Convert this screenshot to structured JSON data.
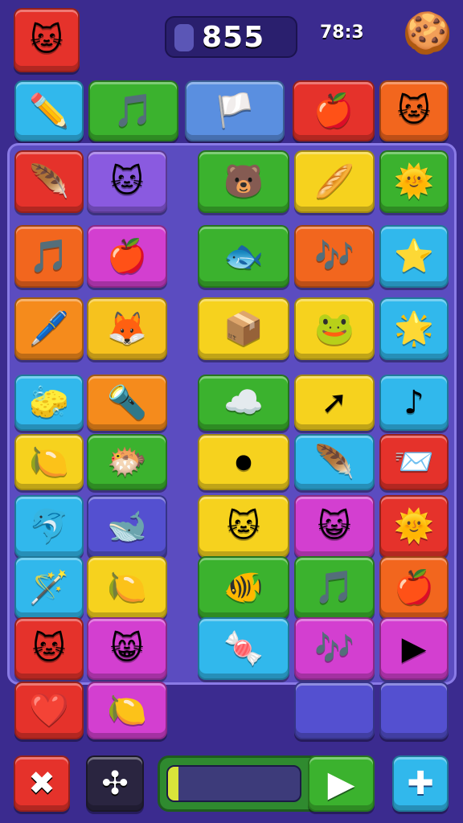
{
  "hud": {
    "score": "855",
    "timer": "78:3"
  },
  "level_progress": 0.08,
  "colors": {
    "background": "#3b2b8f",
    "board": "#5b4cc0",
    "red": "#e5322b",
    "green": "#3bb22e",
    "blue": "#31a8ec",
    "yellow": "#f6d21e",
    "orange": "#f58b1c",
    "purple": "#7a3fd6",
    "magenta": "#d33fd0",
    "indigo": "#5450d0"
  },
  "top_row": [
    {
      "icon": "pencil-icon",
      "glyph": "✏️",
      "color": "#31b8ec"
    },
    {
      "icon": "music-note-icon",
      "glyph": "🎵",
      "color": "#3bb22e"
    },
    {
      "icon": "flag-icon",
      "glyph": "🏳️",
      "color": "#5a8fe0"
    },
    {
      "icon": "apple-icon",
      "glyph": "🍎",
      "color": "#e5322b"
    },
    {
      "icon": "cat-face-icon",
      "glyph": "🐱",
      "color": "#f2661e"
    }
  ],
  "grid_tiles": [
    {
      "icon": "feather-duster-icon",
      "glyph": "🪶",
      "color": "#e5322b"
    },
    {
      "icon": "cat-face-icon",
      "glyph": "🐱",
      "color": "#8a5ae0"
    },
    {
      "icon": "bear-face-icon",
      "glyph": "🐻",
      "color": "#3bb22e"
    },
    {
      "icon": "rolling-pin-icon",
      "glyph": "🥖",
      "color": "#f6d21e"
    },
    {
      "icon": "sun-icon",
      "glyph": "🌞",
      "color": "#3bb22e"
    },
    {
      "icon": "music-note-icon",
      "glyph": "🎵",
      "color": "#f2661e"
    },
    {
      "icon": "apple-icon",
      "glyph": "🍎",
      "color": "#d33fd0"
    },
    {
      "icon": "fish-icon",
      "glyph": "🐟",
      "color": "#3bb22e"
    },
    {
      "icon": "music-notes-icon",
      "glyph": "🎶",
      "color": "#f2661e"
    },
    {
      "icon": "star-icon",
      "glyph": "⭐",
      "color": "#31b8ec"
    },
    {
      "icon": "pencil-icon",
      "glyph": "🖊️",
      "color": "#f58b1c"
    },
    {
      "icon": "fox-face-icon",
      "glyph": "🦊",
      "color": "#f6c21e"
    },
    {
      "icon": "box-icon",
      "glyph": "📦",
      "color": "#f6d21e"
    },
    {
      "icon": "frog-icon",
      "glyph": "🐸",
      "color": "#f6d21e"
    },
    {
      "icon": "star-face-icon",
      "glyph": "🌟",
      "color": "#31b8ec"
    },
    {
      "icon": "eraser-icon",
      "glyph": "🧽",
      "color": "#31b8ec"
    },
    {
      "icon": "flashlight-icon",
      "glyph": "🔦",
      "color": "#f58b1c"
    },
    {
      "icon": "cloud-icon",
      "glyph": "☁️",
      "color": "#3bb22e"
    },
    {
      "icon": "arrow-icon",
      "glyph": "➚",
      "color": "#f6d21e"
    },
    {
      "icon": "music-note-icon",
      "glyph": "♪",
      "color": "#31b8ec"
    },
    {
      "icon": "lemon-icon",
      "glyph": "🍋",
      "color": "#f6d21e"
    },
    {
      "icon": "pufferfish-icon",
      "glyph": "🐡",
      "color": "#3bb22e"
    },
    {
      "icon": "red-button-icon",
      "glyph": "⏺",
      "color": "#f6d21e"
    },
    {
      "icon": "feather-icon",
      "glyph": "🪶",
      "color": "#31b8ec"
    },
    {
      "icon": "paper-plane-icon",
      "glyph": "📨",
      "color": "#e5322b"
    },
    {
      "icon": "dolphin-icon",
      "glyph": "🐬",
      "color": "#31b8ec"
    },
    {
      "icon": "whale-icon",
      "glyph": "🐋",
      "color": "#5450d0"
    },
    {
      "icon": "cat-face-icon",
      "glyph": "🐱",
      "color": "#f6d21e"
    },
    {
      "icon": "cat-face-icon",
      "glyph": "😺",
      "color": "#d33fd0"
    },
    {
      "icon": "sun-face-icon",
      "glyph": "🌞",
      "color": "#e5322b"
    },
    {
      "icon": "wand-icon",
      "glyph": "🪄",
      "color": "#31b8ec"
    },
    {
      "icon": "lemon-icon",
      "glyph": "🍋",
      "color": "#f6d21e"
    },
    {
      "icon": "fish-icon",
      "glyph": "🐠",
      "color": "#3bb22e"
    },
    {
      "icon": "music-note-icon",
      "glyph": "🎵",
      "color": "#3bb22e"
    },
    {
      "icon": "apple-icon",
      "glyph": "🍎",
      "color": "#f2661e"
    },
    {
      "icon": "cat-face-icon",
      "glyph": "🐱",
      "color": "#e5322b"
    },
    {
      "icon": "cat-face-icon",
      "glyph": "😸",
      "color": "#d33fd0"
    },
    {
      "icon": "candy-icon",
      "glyph": "🍬",
      "color": "#31b8ec"
    },
    {
      "icon": "music-note-icon",
      "glyph": "🎶",
      "color": "#d33fd0"
    },
    {
      "icon": "play-icon",
      "glyph": "▶",
      "color": "#d33fd0"
    }
  ],
  "bottom_row": [
    {
      "icon": "heart-icon",
      "glyph": "❤️",
      "color": "#e5322b"
    },
    {
      "icon": "lemon-icon",
      "glyph": "🍋",
      "color": "#d33fd0"
    },
    {
      "icon": "empty-slot",
      "glyph": "",
      "color": "#5450d0"
    },
    {
      "icon": "empty-slot",
      "glyph": "",
      "color": "#5450d0"
    }
  ],
  "controls": {
    "close_glyph": "✖",
    "shuffle_glyph": "✣",
    "play_glyph": "▶",
    "settings_glyph": "✚"
  },
  "corner": {
    "cat_glyph": "🐱",
    "cookie_glyph": "🍪"
  }
}
